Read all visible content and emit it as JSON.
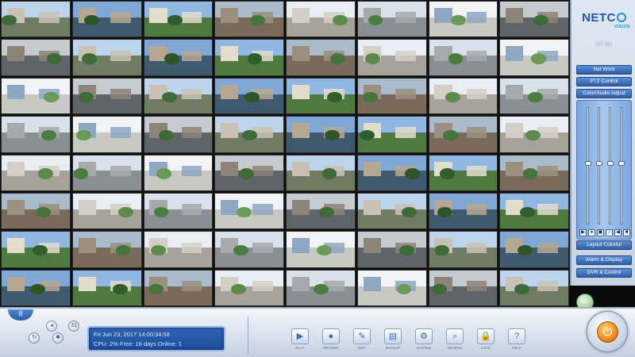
{
  "brand": {
    "name": "NETC",
    "tagline": "VISION"
  },
  "sidebar": {
    "status_title": "NT 6th",
    "buttons": [
      "Net Work",
      "PTZ Control",
      "Color/Audio Adjust",
      "Layout Colorful",
      "Alarm & Display",
      "DVR & Control"
    ],
    "slider_levels": [
      0.52,
      0.52,
      0.52,
      0.52
    ],
    "icons": [
      "play-icon",
      "record-icon",
      "snapshot-icon",
      "audio-icon",
      "speaker-icon",
      "lock-icon"
    ]
  },
  "status_panel": {
    "line1": "Fri Jun 23, 2017  14:00:34:58",
    "line2": "CPU: 2% Free: 16 days   Online: 1"
  },
  "bottom_left": {
    "tab_label": "|||",
    "buttons": [
      "p",
      "r",
      "c",
      "s",
      "31"
    ]
  },
  "toolbar": [
    {
      "name": "play-tool",
      "icon": "▶",
      "label": "PLAY"
    },
    {
      "name": "record-tool",
      "icon": "●",
      "label": "RECORD"
    },
    {
      "name": "edit-tool",
      "icon": "✎",
      "label": "EDIT"
    },
    {
      "name": "backup-tool",
      "icon": "▤",
      "label": "BACKUP"
    },
    {
      "name": "system-tool",
      "icon": "⚙",
      "label": "SYSTEM"
    },
    {
      "name": "search-tool",
      "icon": "⌕",
      "label": "SEARCH"
    },
    {
      "name": "lock-tool",
      "icon": "🔒",
      "label": "LOCK"
    },
    {
      "name": "help-tool",
      "icon": "?",
      "label": "HELP"
    }
  ],
  "cameras": {
    "count": 64,
    "palette": [
      {
        "sky": "#bcd4ec",
        "ground": "#6f7b63",
        "bld": "#c9c2b4",
        "tree": "#3f6b3a"
      },
      {
        "sky": "#d9e2ea",
        "ground": "#8a8f93",
        "bld": "#a7a9ab",
        "tree": "#4a7d3f"
      },
      {
        "sky": "#8fb7e1",
        "ground": "#4f7a3f",
        "bld": "#e2dccb",
        "tree": "#2f5d2b"
      },
      {
        "sky": "#c6cbd0",
        "ground": "#5f6468",
        "bld": "#8d8479",
        "tree": "#3d6a35"
      },
      {
        "sky": "#e8eef4",
        "ground": "#a6a39a",
        "bld": "#d3cfc7",
        "tree": "#5c8a4a"
      },
      {
        "sky": "#7fa8d6",
        "ground": "#3f5a6f",
        "bld": "#b6a792",
        "tree": "#2e5526"
      },
      {
        "sky": "#f1f3f5",
        "ground": "#c9c9c4",
        "bld": "#8ea7c3",
        "tree": "#6a9a58"
      },
      {
        "sky": "#aabccc",
        "ground": "#7a6a5a",
        "bld": "#9b8f7f",
        "tree": "#46753c"
      }
    ]
  }
}
